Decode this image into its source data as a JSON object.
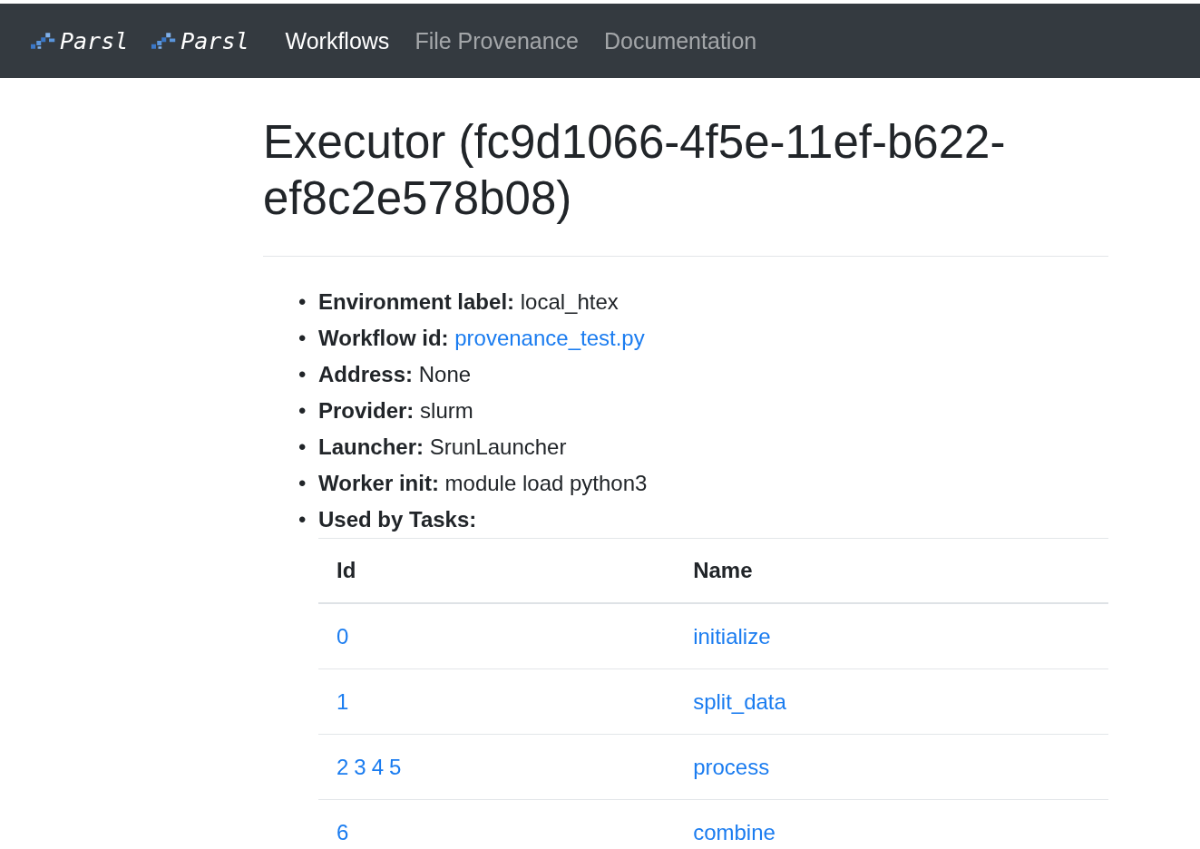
{
  "navbar": {
    "brands": [
      {
        "text": "Parsl"
      },
      {
        "text": "Parsl"
      }
    ],
    "links": [
      {
        "label": "Workflows",
        "selected": true
      },
      {
        "label": "File Provenance",
        "selected": false
      },
      {
        "label": "Documentation",
        "selected": false
      }
    ]
  },
  "title": "Executor (fc9d1066-4f5e-11ef-b622-ef8c2e578b08)",
  "details": [
    {
      "bullet": "•",
      "label": "Environment label:",
      "value": "local_htex",
      "kind": "text"
    },
    {
      "bullet": "•",
      "label": "Workflow id:",
      "value": "provenance_test.py",
      "kind": "link"
    },
    {
      "bullet": "•",
      "label": "Address:",
      "value": "None",
      "kind": "text"
    },
    {
      "bullet": "•",
      "label": "Provider:",
      "value": "slurm",
      "kind": "text"
    },
    {
      "bullet": "•",
      "label": "Launcher:",
      "value": "SrunLauncher",
      "kind": "text"
    },
    {
      "bullet": "•",
      "label": "Worker init:",
      "value": "module load python3",
      "kind": "text"
    },
    {
      "bullet": "•",
      "label": "Used by Tasks:",
      "kind": "heading"
    }
  ],
  "tasks_table": {
    "columns": [
      "Id",
      "Name"
    ],
    "rows": [
      {
        "ids": [
          "0"
        ],
        "name": "initialize"
      },
      {
        "ids": [
          "1"
        ],
        "name": "split_data"
      },
      {
        "ids": [
          "2",
          "3",
          "4",
          "5"
        ],
        "name": "process"
      },
      {
        "ids": [
          "6"
        ],
        "name": "combine"
      }
    ]
  }
}
